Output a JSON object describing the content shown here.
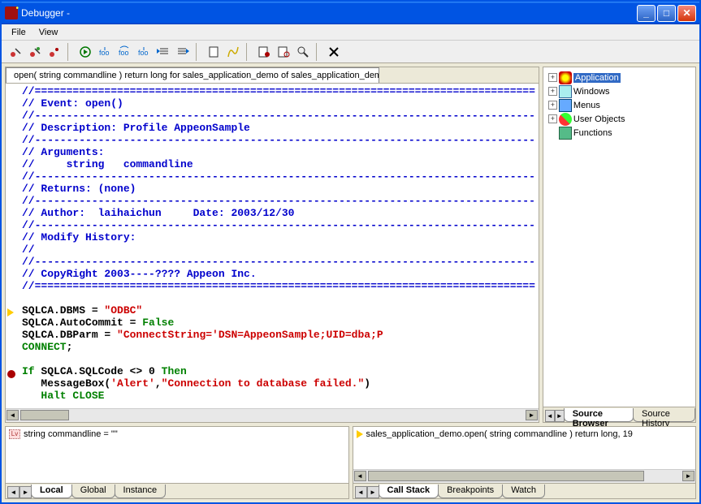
{
  "window": {
    "title": "Debugger -"
  },
  "menu": {
    "file": "File",
    "view": "View"
  },
  "source_tab": "open( string commandline  ) return long for sales_application_demo of sales_application_demo",
  "code": {
    "sep": "//===============================================================================",
    "l1": "// Event: open()",
    "l2": "//-------------------------------------------------------------------------------",
    "l3": "// Description: Profile AppeonSample",
    "l4": "// Arguments:",
    "l5": "//     string   commandline",
    "l6": "// Returns: (none)",
    "l7": "// Author:  laihaichun     Date: 2003/12/30",
    "l8": "// Modify History:",
    "l9": "//",
    "l10": "// CopyRight 2003----???? Appeon Inc.",
    "s1a": "SQLCA.DBMS = ",
    "s1b": "\"ODBC\"",
    "s2a": "SQLCA.AutoCommit = ",
    "s2b": "False",
    "s3a": "SQLCA.DBParm = ",
    "s3b": "\"ConnectString='DSN=AppeonSample;UID=dba;P",
    "s4": "CONNECT",
    "semicolon": ";",
    "if": "If",
    "ifc": " SQLCA.SQLCode <> 0 ",
    "then": "Then",
    "mb1": "   MessageBox(",
    "mb2": "'Alert'",
    "mb3": ",",
    "mb4": "\"Connection to database failed.\"",
    "mb5": ")",
    "halt": "   Halt",
    "close": " CLOSE"
  },
  "tree": {
    "app": "Application",
    "win": "Windows",
    "menu": "Menus",
    "uo": "User Objects",
    "fn": "Functions"
  },
  "browser_tabs": {
    "a": "Source Browser",
    "b": "Source History"
  },
  "local": {
    "var": "string commandline = \"\""
  },
  "local_tabs": {
    "a": "Local",
    "b": "Global",
    "c": "Instance"
  },
  "stack": {
    "frame": "sales_application_demo.open( string commandline  ) return long, 19"
  },
  "stack_tabs": {
    "a": "Call Stack",
    "b": "Breakpoints",
    "c": "Watch"
  }
}
